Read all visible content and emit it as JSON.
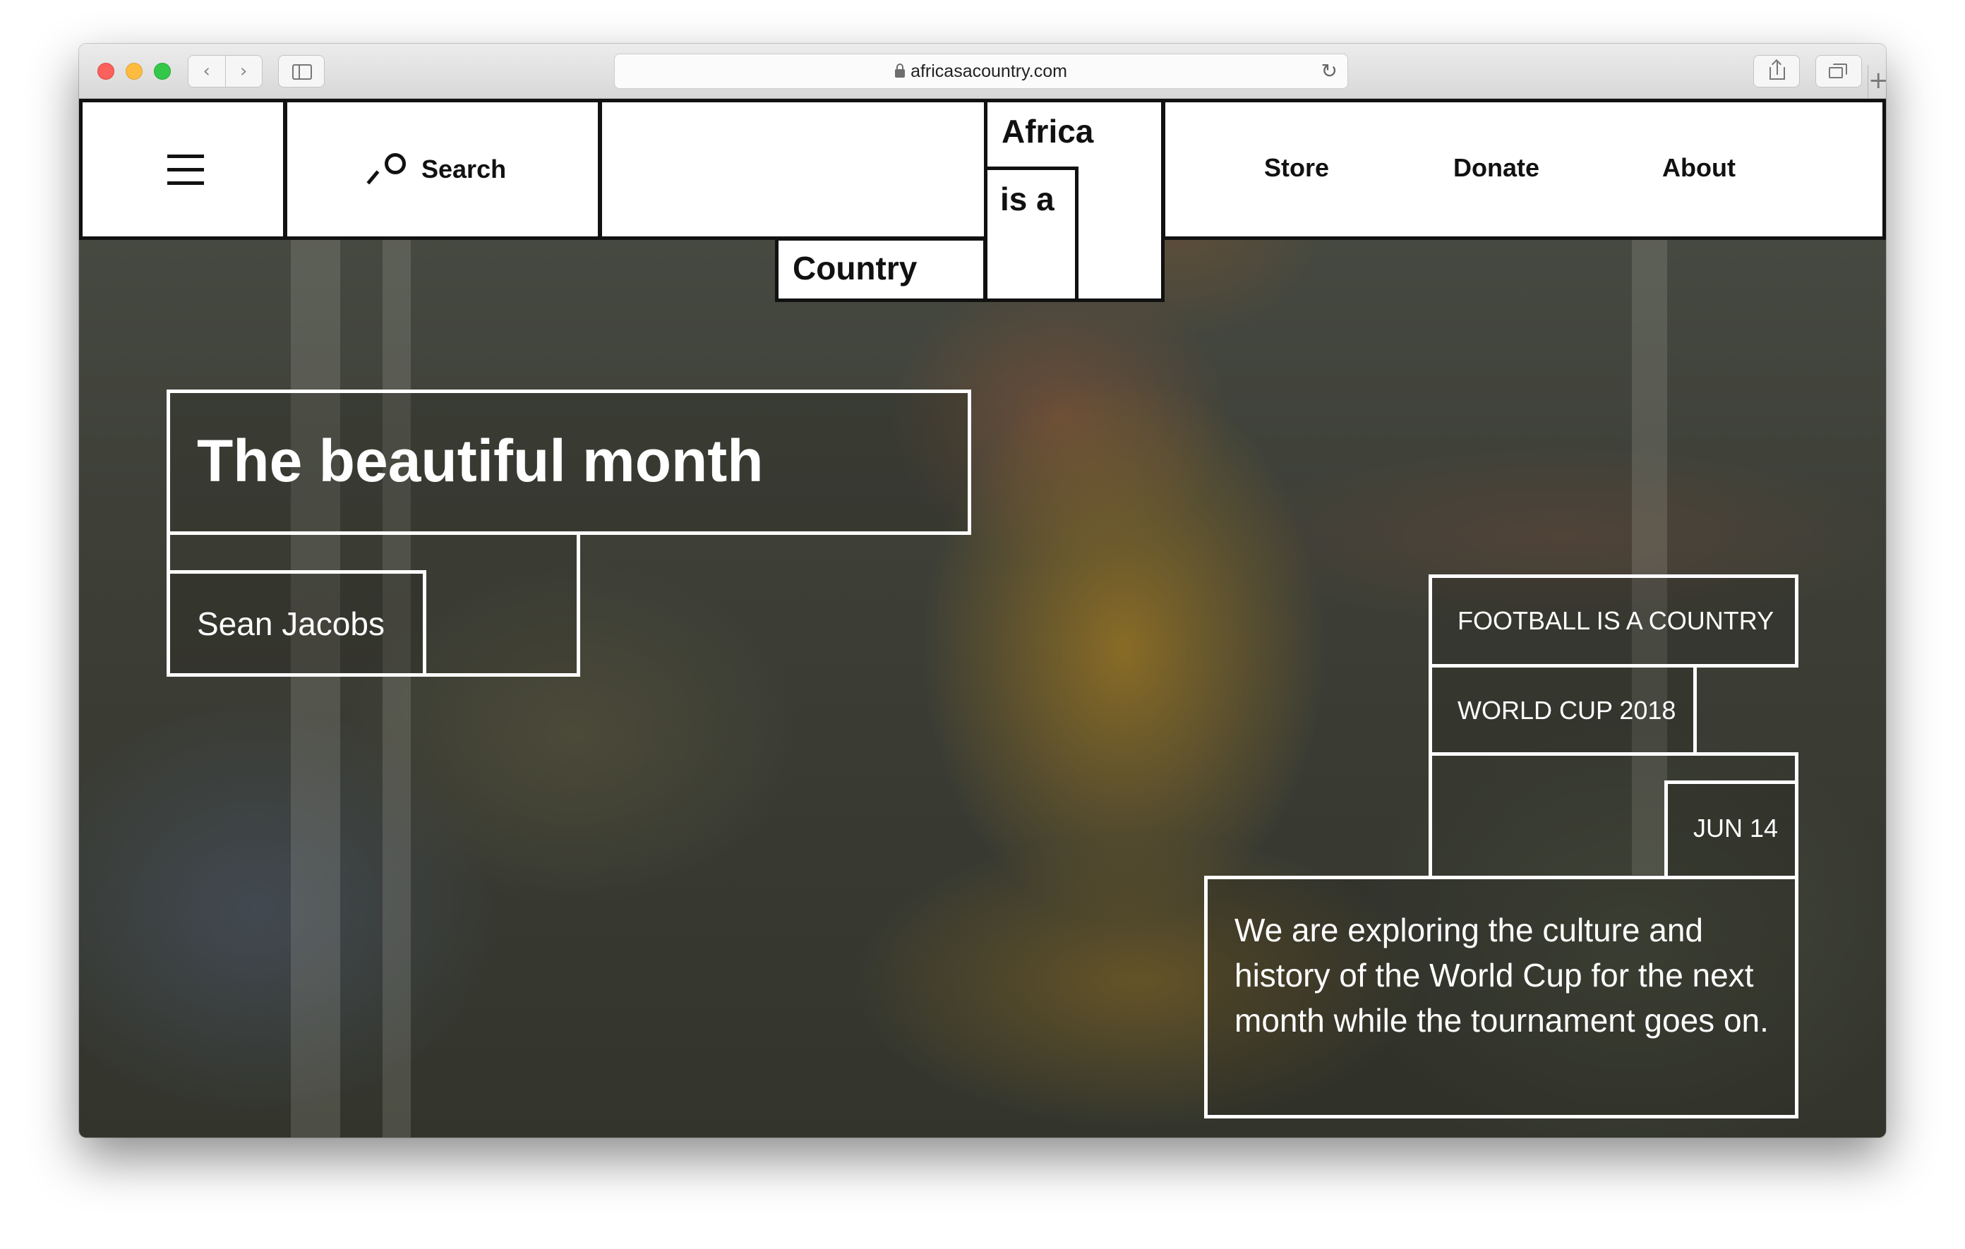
{
  "browser": {
    "url": "africasacountry.com",
    "back_glyph": "‹",
    "forward_glyph": "›",
    "reload_glyph": "↻",
    "newtab_glyph": "+"
  },
  "header": {
    "search_label": "Search",
    "logo_line1": "Africa",
    "logo_line2": "is a",
    "logo_line3": "Country",
    "nav": [
      "Store",
      "Donate",
      "About"
    ]
  },
  "article": {
    "title": "The beautiful month",
    "author": "Sean Jacobs",
    "tags": [
      "FOOTBALL IS A COUNTRY",
      "WORLD CUP 2018"
    ],
    "date": "JUN 14",
    "excerpt": "We are exploring the culture and history of the World Cup for the next month while the tournament goes on."
  },
  "colors": {
    "header_bg": "#ffffff",
    "header_border": "#111111",
    "overlay_text": "#ffffff"
  }
}
